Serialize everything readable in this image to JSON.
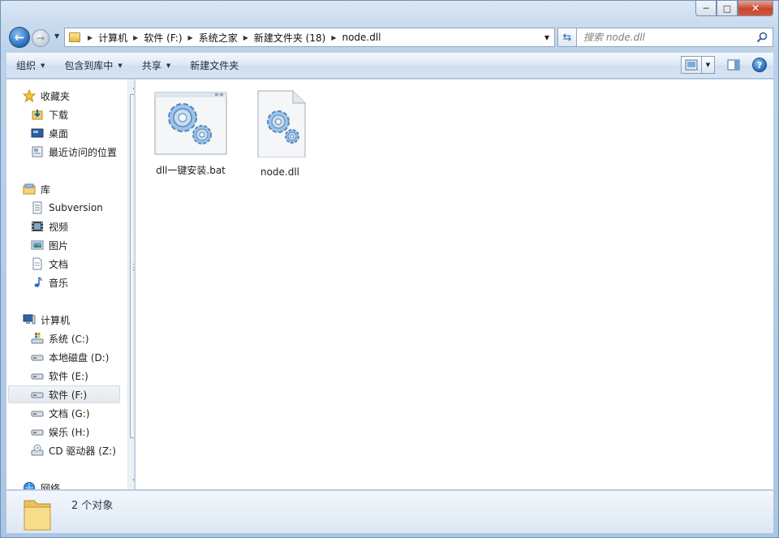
{
  "window": {
    "minimize_glyph": "─",
    "maximize_glyph": "□",
    "close_glyph": "✕"
  },
  "address": {
    "breadcrumbs": [
      "计算机",
      "软件 (F:)",
      "系统之家",
      "新建文件夹 (18)",
      "node.dll"
    ],
    "separator": "▶"
  },
  "search": {
    "placeholder": "搜索 node.dll"
  },
  "toolbar": {
    "organize": "组织",
    "include_in_library": "包含到库中",
    "share": "共享",
    "new_folder": "新建文件夹",
    "help_glyph": "?"
  },
  "sidebar": {
    "favorites": {
      "header": "收藏夹",
      "items": [
        "下载",
        "桌面",
        "最近访问的位置"
      ]
    },
    "libraries": {
      "header": "库",
      "items": [
        "Subversion",
        "视频",
        "图片",
        "文档",
        "音乐"
      ]
    },
    "computer": {
      "header": "计算机",
      "items": [
        "系统 (C:)",
        "本地磁盘 (D:)",
        "软件 (E:)",
        "软件 (F:)",
        "文档 (G:)",
        "娱乐 (H:)",
        "CD 驱动器 (Z:)"
      ],
      "selected": "软件 (F:)"
    },
    "network": {
      "header": "网络"
    }
  },
  "files": [
    {
      "name": "dll一键安装.bat",
      "icon": "batch-file-gear-icon"
    },
    {
      "name": "node.dll",
      "icon": "dll-file-gear-icon"
    }
  ],
  "details": {
    "count_text": "2 个对象"
  },
  "colors": {
    "accent": "#2a6fc0",
    "close_red": "#c9462c",
    "chrome": "#c9dbef"
  }
}
